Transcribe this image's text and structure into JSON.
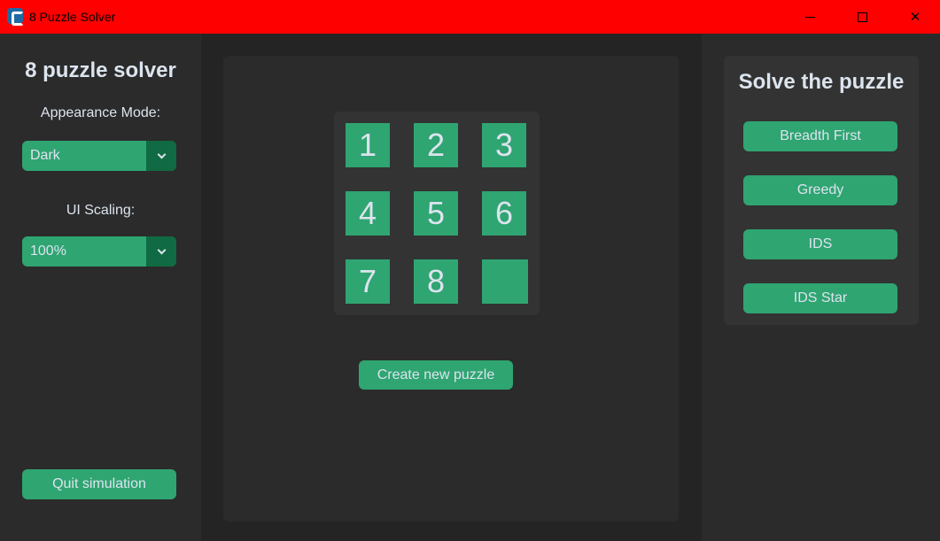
{
  "window": {
    "title": "8 Puzzle Solver",
    "minimize_symbol": "",
    "close_symbol": "✕"
  },
  "sidebar": {
    "title": "8 puzzle solver",
    "appearance_label": "Appearance Mode:",
    "appearance_value": "Dark",
    "scaling_label": "UI Scaling:",
    "scaling_value": "100%",
    "quit_label": "Quit simulation"
  },
  "board": {
    "tiles": [
      "1",
      "2",
      "3",
      "4",
      "5",
      "6",
      "7",
      "8",
      ""
    ],
    "create_label": "Create new puzzle"
  },
  "solver": {
    "title": "Solve the puzzle",
    "buttons": [
      "Breadth First",
      "Greedy",
      "IDS",
      "IDS Star"
    ]
  },
  "colors": {
    "titlebar": "#ff0000",
    "accent": "#2fa572",
    "accent_dark": "#106a43",
    "panel": "#2b2b2b",
    "background": "#242424"
  }
}
